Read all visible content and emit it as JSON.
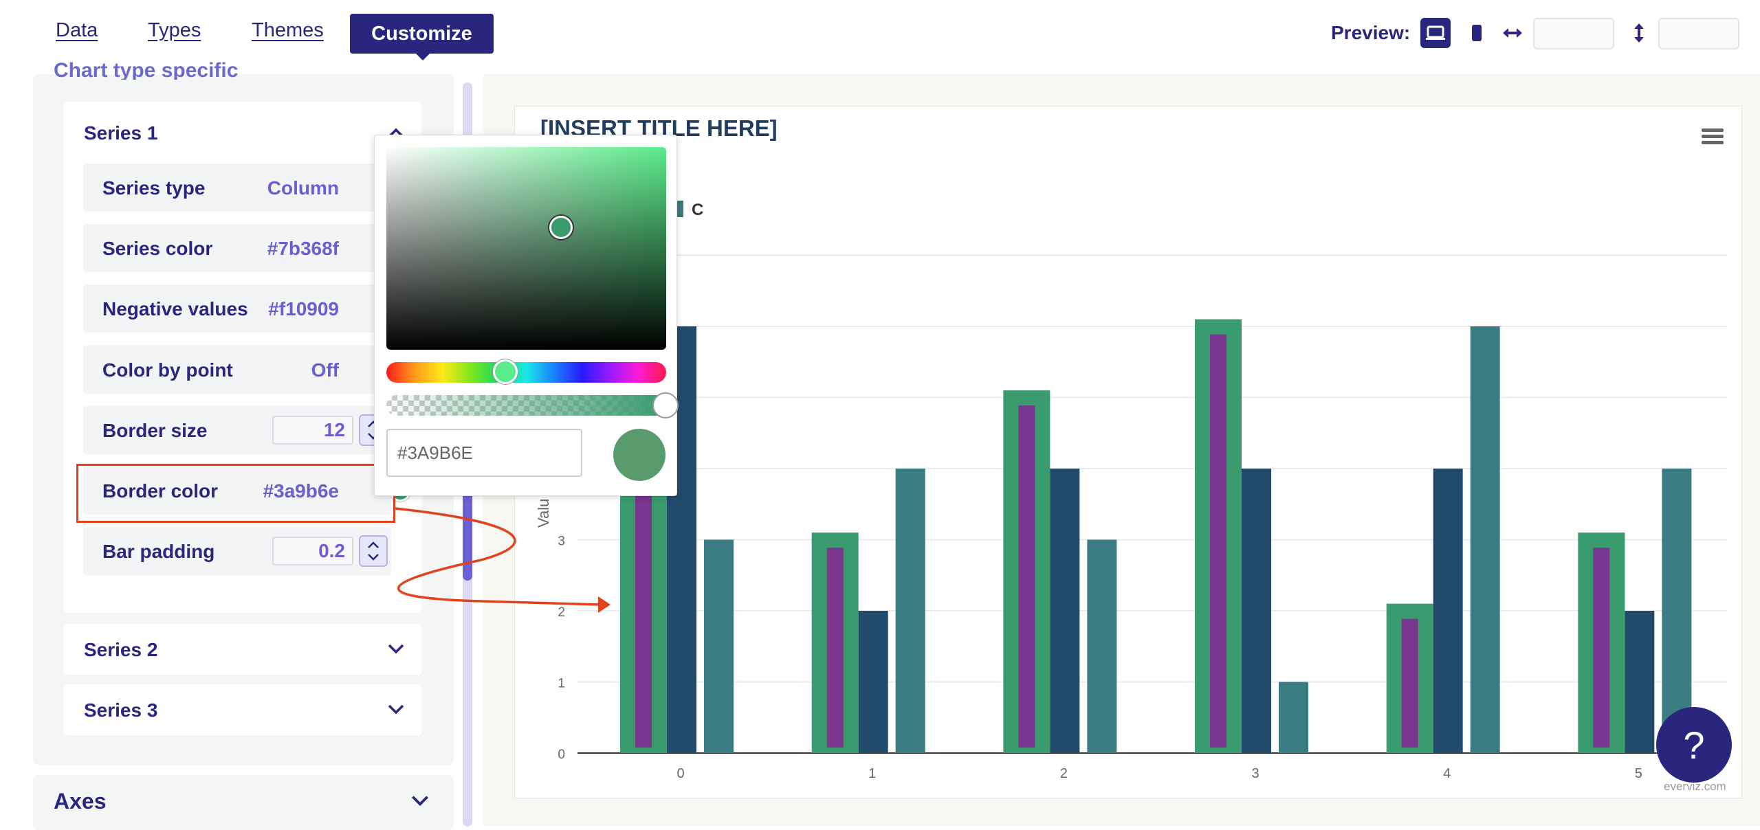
{
  "nav": {
    "tabs": [
      {
        "label": "Data"
      },
      {
        "label": "Types"
      },
      {
        "label": "Themes"
      },
      {
        "label": "Customize"
      }
    ],
    "preview_label": "Preview:"
  },
  "left_panel": {
    "section_title": "Chart type specific",
    "series1": {
      "title": "Series 1",
      "rows": {
        "series_type": {
          "label": "Series type",
          "value": "Column"
        },
        "series_color": {
          "label": "Series color",
          "value": "#7b368f",
          "swatch": "#7b368f"
        },
        "negative_values": {
          "label": "Negative values",
          "value": "#f10909",
          "swatch": "#f10909"
        },
        "color_by_point": {
          "label": "Color by point",
          "value": "Off"
        },
        "border_size": {
          "label": "Border size",
          "value": "12"
        },
        "border_color": {
          "label": "Border color",
          "value": "#3a9b6e",
          "swatch": "#3a9b6e"
        },
        "bar_padding": {
          "label": "Bar padding",
          "value": "0.2"
        }
      }
    },
    "series2": {
      "title": "Series 2"
    },
    "series3": {
      "title": "Series 3"
    },
    "axes": {
      "title": "Axes"
    }
  },
  "color_picker": {
    "hex_value": "#3A9B6E",
    "current_color": "#3a9b6e"
  },
  "chart": {
    "title": "[INSERT TITLE HERE]",
    "legend_visible": "C",
    "y_axis_label_visible": "Valu",
    "watermark": "everviz.com",
    "help_label": "?"
  },
  "chart_data": {
    "type": "bar",
    "title": "[INSERT TITLE HERE]",
    "categories": [
      "0",
      "1",
      "2",
      "3",
      "4",
      "5"
    ],
    "y_ticks": [
      "0",
      "1",
      "2",
      "3"
    ],
    "ylim": [
      0,
      7
    ],
    "series": [
      {
        "values": [
          5.9,
          3.1,
          5.1,
          6.1,
          2.1,
          3.1
        ],
        "color": "#7b368f",
        "border_color": "#3a9b6e"
      },
      {
        "values": [
          6,
          2,
          4,
          4,
          4,
          2
        ],
        "color": "#214a6b"
      },
      {
        "name": "C",
        "values": [
          3,
          4,
          3,
          1,
          6,
          4
        ],
        "color": "#3a7c82"
      }
    ]
  },
  "colors": {
    "brand": "#28277d",
    "accent": "#6b5fcf",
    "annotation": "#e0441f"
  }
}
